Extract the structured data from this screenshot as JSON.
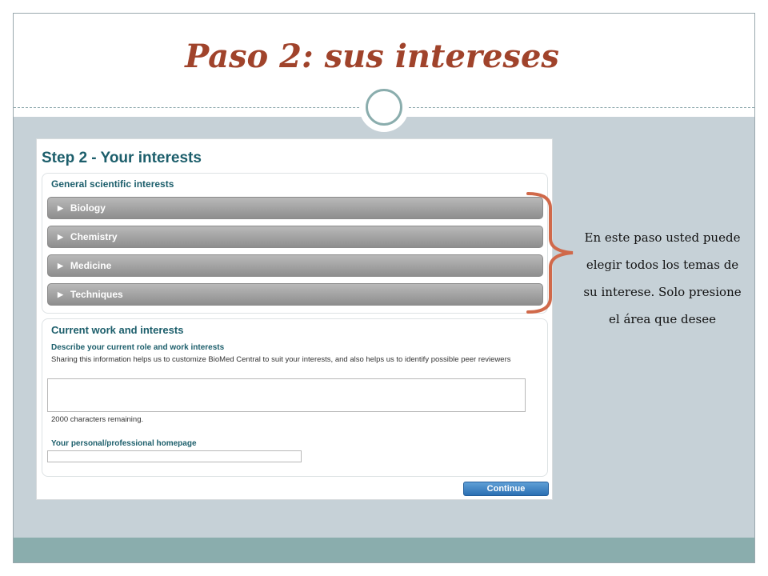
{
  "slide": {
    "title": "Paso 2: sus intereses",
    "side_note": "En este paso usted puede elegir todos  los temas de su interese. Solo  presione el área que  desee",
    "colors": {
      "title": "#a0432b",
      "accent": "#8aadad",
      "brace": "#d0694a",
      "content_bg": "#c6d1d7"
    }
  },
  "form": {
    "step_title": "Step 2 - Your interests",
    "general": {
      "heading": "General scientific interests",
      "items": [
        {
          "label": "Biology"
        },
        {
          "label": "Chemistry"
        },
        {
          "label": "Medicine"
        },
        {
          "label": "Techniques"
        }
      ]
    },
    "work": {
      "heading": "Current work and interests",
      "role_label": "Describe your current role and work interests",
      "help": "Sharing this information helps us to customize BioMed Central to suit your interests, and also helps us to identify possible peer reviewers",
      "chars_remaining": "2000 characters remaining.",
      "homepage_label": "Your personal/professional homepage",
      "role_value": "",
      "homepage_value": ""
    },
    "continue_label": "Continue"
  }
}
